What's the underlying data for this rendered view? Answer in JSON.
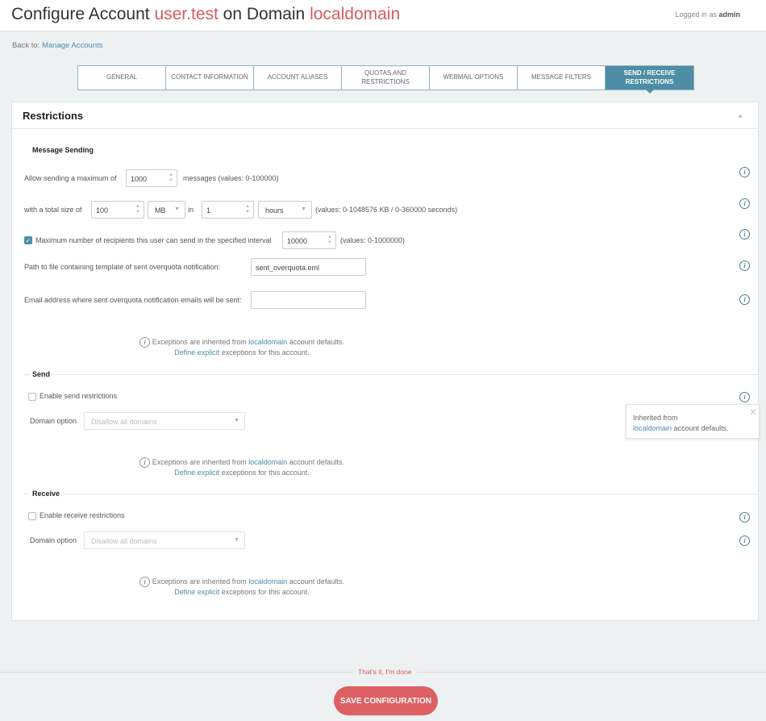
{
  "header": {
    "title_prefix": "Configure Account ",
    "account": "user.test",
    "title_mid": " on Domain ",
    "domain": "localdomain",
    "logged_prefix": "Logged in as ",
    "user": "admin"
  },
  "breadcrumb": {
    "prefix": "Back to: ",
    "link": "Manage Accounts"
  },
  "tabs": [
    {
      "label": "General"
    },
    {
      "label": "Contact Information"
    },
    {
      "label": "Account Aliases"
    },
    {
      "label": "Quotas and Restrictions"
    },
    {
      "label": "Webmail Options"
    },
    {
      "label": "Message Filters"
    },
    {
      "label": "Send / Receive Restrictions",
      "active": true
    }
  ],
  "panel": {
    "title": "Restrictions",
    "collapse_icon": "triangle-up-icon"
  },
  "sending": {
    "heading": "Message Sending",
    "max_label": "Allow sending a maximum of",
    "max_value": "1000",
    "max_suffix": "messages (values: 0-100000)",
    "size_label": "with a total size of",
    "size_value": "100",
    "size_unit": "MB",
    "in_label": "in",
    "interval_value": "1",
    "interval_unit": "hours",
    "size_hint": "(values: 0-1048576 KB / 0-360000 seconds)",
    "recip_checked": true,
    "recip_label": "Maximum number of recipients this user can send in the specified interval",
    "recip_value": "10000",
    "recip_hint": "(values: 0-1000000)",
    "path_label": "Path to file containing template of sent overquota notification:",
    "path_value": "sent_overquota.eml",
    "email_label": "Email address where sent overquota notification emails will be sent:",
    "email_value": ""
  },
  "note": {
    "text1": "Exceptions are inherited from ",
    "link1": "localdomain",
    "text2": " account defaults.",
    "link2": "Define explicit",
    "text3": " exceptions for this account."
  },
  "send": {
    "heading": "Send",
    "enable_label": "Enable send restrictions",
    "enabled": false,
    "domain_label": "Domain option",
    "domain_value": "Disallow all domains"
  },
  "receive": {
    "heading": "Receive",
    "enable_label": "Enable receive restrictions",
    "enabled": false,
    "domain_label": "Domain option",
    "domain_value": "Disallow all domains"
  },
  "tooltip": {
    "line1": "Inherited from",
    "link": "localdomain",
    "line2": " account defaults."
  },
  "footer": {
    "done": "That's it, I'm done",
    "save": "SAVE CONFIGURATION"
  },
  "colors": {
    "accent": "#4d8ea6",
    "highlight": "#d65b5f",
    "save": "#dd6062"
  }
}
